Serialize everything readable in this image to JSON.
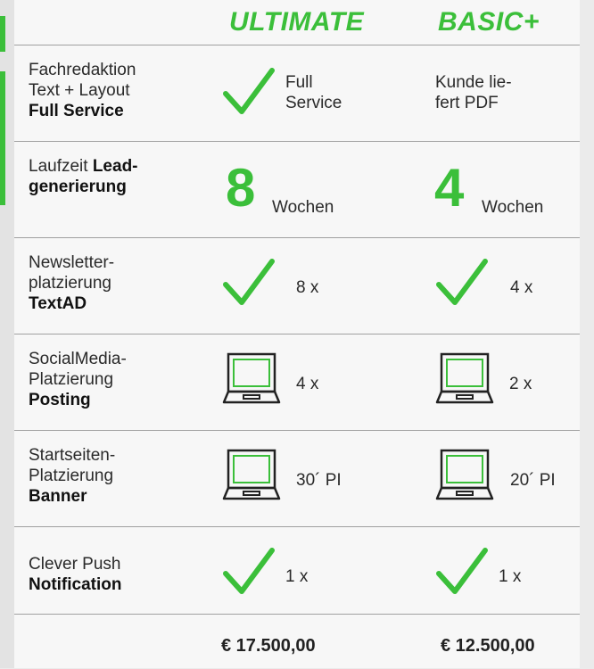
{
  "columns": {
    "ultimate": "ULTIMATE",
    "basic": "BASIC+"
  },
  "colors": {
    "accent": "#3bbf3a",
    "divider": "#a0a0a0"
  },
  "rows": [
    {
      "label_lines": [
        "Fachredaktion",
        "Text + Layout"
      ],
      "label_bold": "Full Service",
      "ultimate": {
        "icon": "checkmark-icon",
        "text_lines": [
          "Full",
          "Service"
        ]
      },
      "basic": {
        "text_lines": [
          "Kunde lie-",
          "fert PDF"
        ]
      }
    },
    {
      "label_prefix": "Laufzeit ",
      "label_bold_lines": [
        "Lead-",
        "generierung"
      ],
      "ultimate": {
        "number": "8",
        "unit": "Wochen"
      },
      "basic": {
        "number": "4",
        "unit": "Wochen"
      }
    },
    {
      "label_lines": [
        "Newsletter-",
        "platzierung"
      ],
      "label_bold": "TextAD",
      "ultimate": {
        "icon": "checkmark-icon",
        "text": "8 x"
      },
      "basic": {
        "icon": "checkmark-icon",
        "text": "4 x"
      }
    },
    {
      "label_lines": [
        "SocialMedia-",
        "Platzierung"
      ],
      "label_bold": "Posting",
      "ultimate": {
        "icon": "laptop-icon",
        "text": "4 x"
      },
      "basic": {
        "icon": "laptop-icon",
        "text": "2 x"
      }
    },
    {
      "label_lines": [
        "Startseiten-",
        "Platzierung"
      ],
      "label_bold": "Banner",
      "ultimate": {
        "icon": "laptop-icon",
        "text": "30´ PI"
      },
      "basic": {
        "icon": "laptop-icon",
        "text": "20´ PI"
      }
    },
    {
      "label_lines": [
        "Clever Push"
      ],
      "label_bold": "Notification",
      "ultimate": {
        "icon": "checkmark-icon",
        "text": "1 x"
      },
      "basic": {
        "icon": "checkmark-icon",
        "text": "1 x"
      }
    }
  ],
  "prices": {
    "ultimate": "€ 17.500,00",
    "basic": "€ 12.500,00"
  }
}
